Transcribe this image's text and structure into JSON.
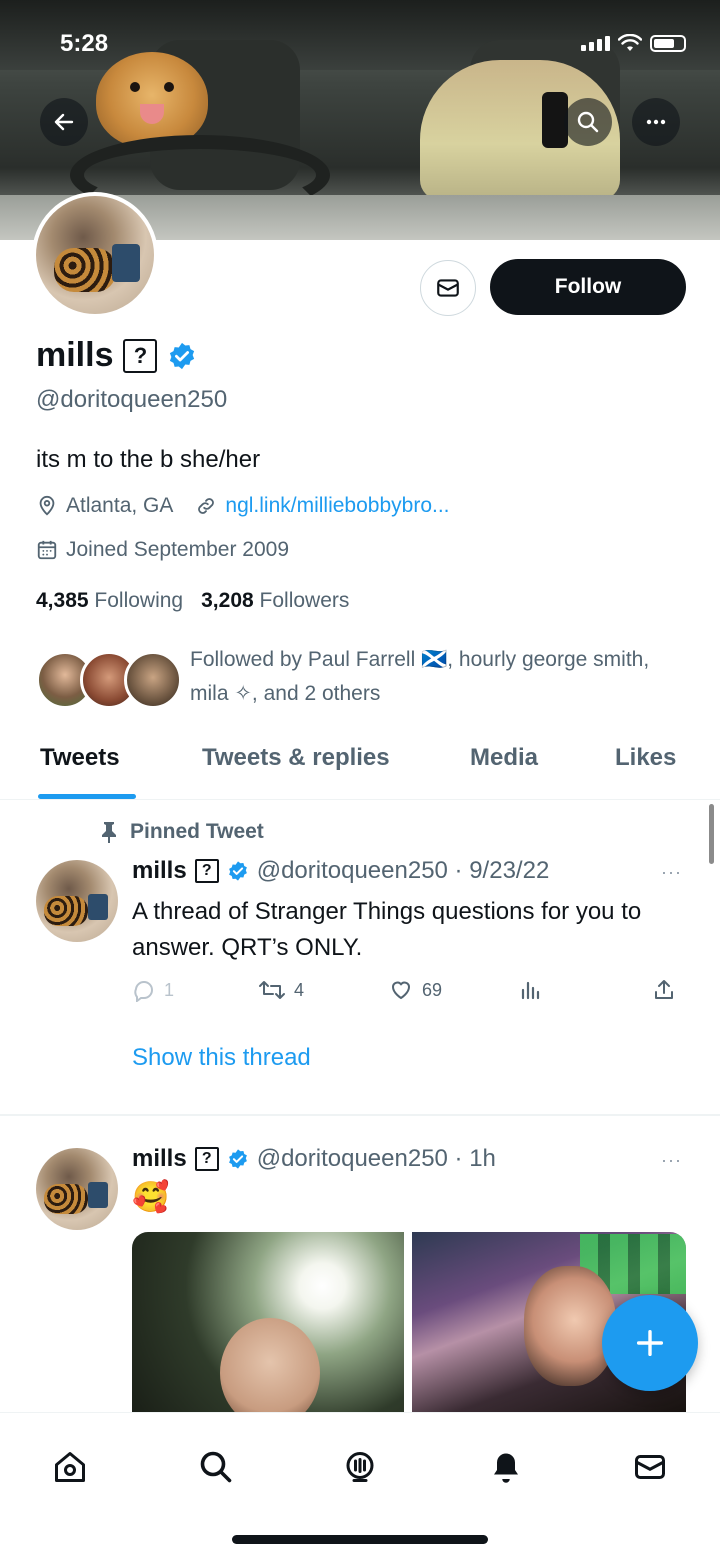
{
  "status_bar": {
    "time": "5:28"
  },
  "header": {},
  "profile": {
    "display_name": "mills",
    "name_badge": "?",
    "handle": "@doritoqueen250",
    "bio": "its m to the b she/her",
    "location": "Atlanta, GA",
    "link": "ngl.link/milliebobbybro...",
    "joined": "Joined September 2009",
    "following_count": "4,385",
    "following_label": "Following",
    "followers_count": "3,208",
    "followers_label": "Followers",
    "follow_button": "Follow",
    "followed_by_text": "Followed by Paul Farrell 🏴󠁧󠁢󠁳󠁣󠁴󠁿, hourly george smith, mila ✧, and 2 others"
  },
  "tabs": [
    {
      "label": "Tweets",
      "active": true
    },
    {
      "label": "Tweets & replies",
      "active": false
    },
    {
      "label": "Media",
      "active": false
    },
    {
      "label": "Likes",
      "active": false
    }
  ],
  "tweets": [
    {
      "pinned_label": "Pinned Tweet",
      "name": "mills",
      "badge": "?",
      "handle_date": "@doritoqueen250 · 9/23/22",
      "more": "···",
      "text": "A thread of Stranger Things questions for you to answer. QRT’s ONLY.",
      "replies": "1",
      "retweets": "4",
      "likes": "69",
      "show_thread": "Show this thread"
    },
    {
      "name": "mills",
      "badge": "?",
      "handle_date": "@doritoqueen250 · 1h",
      "more": "···",
      "text": "🥰"
    }
  ],
  "colors": {
    "accent": "#1d9bf0",
    "text": "#0f1419",
    "secondary": "#536471",
    "follow_bg": "#0f1419"
  },
  "icons": {
    "back": "back-arrow-icon",
    "search": "search-icon",
    "more": "more-icon",
    "message": "envelope-icon",
    "verified": "verified-badge-icon",
    "location": "location-pin-icon",
    "link": "link-icon",
    "calendar": "calendar-icon",
    "pin": "pin-icon",
    "reply": "reply-icon",
    "retweet": "retweet-icon",
    "like": "heart-icon",
    "views": "analytics-icon",
    "share": "share-icon",
    "compose": "plus-icon",
    "nav": [
      "home-icon",
      "search-icon",
      "spaces-icon",
      "notifications-icon",
      "messages-icon"
    ]
  }
}
